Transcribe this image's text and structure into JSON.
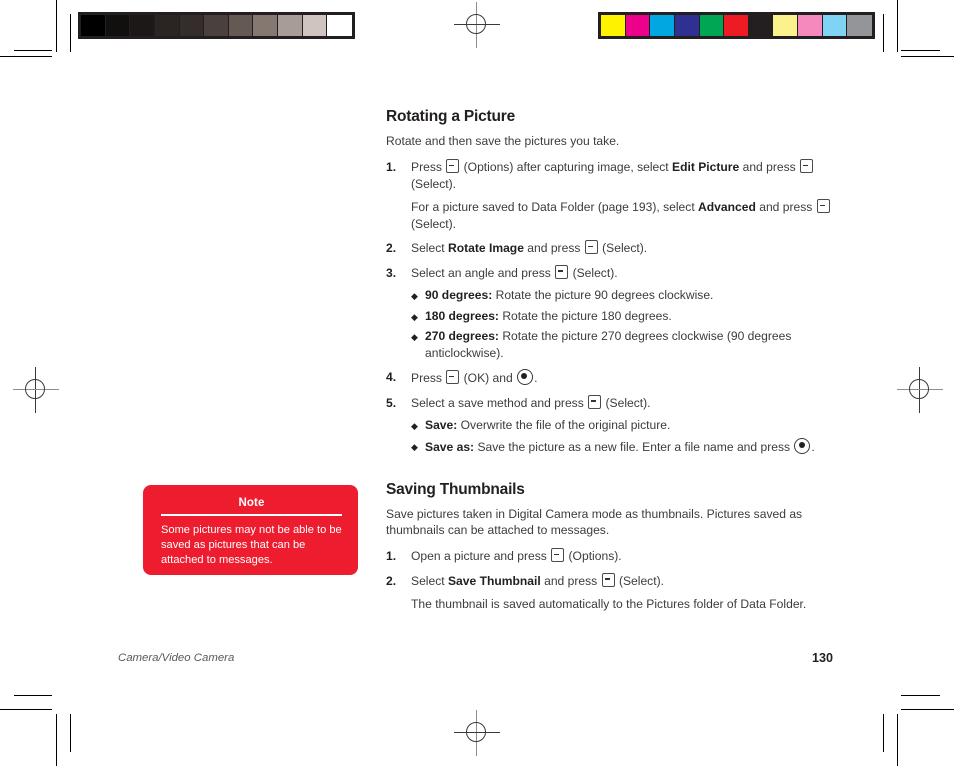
{
  "print_marks": {
    "gray_strip": {
      "name": "grayscale-calibration-strip",
      "patches": [
        "#000000",
        "#120f0f",
        "#1c1817",
        "#2a2422",
        "#342d2b",
        "#4a403d",
        "#655954",
        "#847871",
        "#a79c96",
        "#cfc4bf",
        "#ffffff"
      ]
    },
    "color_strip": {
      "name": "color-calibration-strip",
      "patches": [
        "#fff200",
        "#ec008c",
        "#00a7e1",
        "#2e3192",
        "#00a651",
        "#ed1c24",
        "#231f20",
        "#fbf18d",
        "#f589bd",
        "#7fd4f5",
        "#939598"
      ]
    }
  },
  "content": {
    "section1": {
      "title": "Rotating a Picture",
      "intro": "Rotate and then save the pictures you take.",
      "steps": [
        {
          "num": "1.",
          "parts": [
            {
              "t": "text",
              "v": "Press "
            },
            {
              "t": "softkey"
            },
            {
              "t": "text",
              "v": " (Options) after capturing image, select "
            },
            {
              "t": "bold",
              "v": "Edit Picture"
            },
            {
              "t": "text",
              "v": " and press "
            },
            {
              "t": "softkey"
            },
            {
              "t": "text",
              "v": " (Select)."
            }
          ],
          "sub": [
            {
              "t": "text",
              "v": "For a picture saved to Data Folder (page 193), select "
            },
            {
              "t": "bold",
              "v": "Advanced"
            },
            {
              "t": "text",
              "v": " and press "
            },
            {
              "t": "softkey"
            },
            {
              "t": "text",
              "v": " (Select)."
            }
          ]
        },
        {
          "num": "2.",
          "parts": [
            {
              "t": "text",
              "v": "Select "
            },
            {
              "t": "bold",
              "v": "Rotate Image"
            },
            {
              "t": "text",
              "v": " and press "
            },
            {
              "t": "softkey"
            },
            {
              "t": "text",
              "v": " (Select)."
            }
          ]
        },
        {
          "num": "3.",
          "parts": [
            {
              "t": "text",
              "v": "Select an angle and press "
            },
            {
              "t": "softkey"
            },
            {
              "t": "text",
              "v": " (Select)."
            }
          ],
          "bullets": [
            [
              {
                "t": "bold",
                "v": "90 degrees:"
              },
              {
                "t": "text",
                "v": " Rotate the picture 90 degrees clockwise."
              }
            ],
            [
              {
                "t": "bold",
                "v": "180 degrees:"
              },
              {
                "t": "text",
                "v": " Rotate the picture 180 degrees."
              }
            ],
            [
              {
                "t": "bold",
                "v": "270 degrees:"
              },
              {
                "t": "text",
                "v": " Rotate the picture 270 degrees clockwise (90 degrees anticlockwise)."
              }
            ]
          ]
        },
        {
          "num": "4.",
          "parts": [
            {
              "t": "text",
              "v": "Press "
            },
            {
              "t": "softkey"
            },
            {
              "t": "text",
              "v": " (OK) and "
            },
            {
              "t": "centerkey"
            },
            {
              "t": "text",
              "v": "."
            }
          ]
        },
        {
          "num": "5.",
          "parts": [
            {
              "t": "text",
              "v": "Select a save method and press "
            },
            {
              "t": "softkey"
            },
            {
              "t": "text",
              "v": " (Select)."
            }
          ],
          "bullets": [
            [
              {
                "t": "bold",
                "v": "Save:"
              },
              {
                "t": "text",
                "v": " Overwrite the file of the original picture."
              }
            ],
            [
              {
                "t": "bold",
                "v": "Save as:"
              },
              {
                "t": "text",
                "v": " Save the picture as a new file. Enter a file name and press "
              },
              {
                "t": "centerkey"
              },
              {
                "t": "text",
                "v": "."
              }
            ]
          ]
        }
      ]
    },
    "section2": {
      "title": "Saving Thumbnails",
      "intro": "Save pictures taken in Digital Camera mode as thumbnails. Pictures saved as thumbnails can be attached to messages.",
      "steps": [
        {
          "num": "1.",
          "parts": [
            {
              "t": "text",
              "v": "Open a picture and press "
            },
            {
              "t": "softkey"
            },
            {
              "t": "text",
              "v": " (Options)."
            }
          ]
        },
        {
          "num": "2.",
          "parts": [
            {
              "t": "text",
              "v": "Select "
            },
            {
              "t": "bold",
              "v": "Save Thumbnail"
            },
            {
              "t": "text",
              "v": " and press "
            },
            {
              "t": "softkey"
            },
            {
              "t": "text",
              "v": " (Select)."
            }
          ],
          "sub": [
            {
              "t": "text",
              "v": "The thumbnail is saved automatically to the Pictures folder of Data Folder."
            }
          ]
        }
      ]
    }
  },
  "note": {
    "title": "Note",
    "text": "Some pictures may not be able to be saved as pictures that can be attached to messages.",
    "background_color": "#ED1C2E",
    "text_color": "#FFFFFF"
  },
  "footer": {
    "chapter": "Camera/Video Camera",
    "page_number": "130"
  }
}
